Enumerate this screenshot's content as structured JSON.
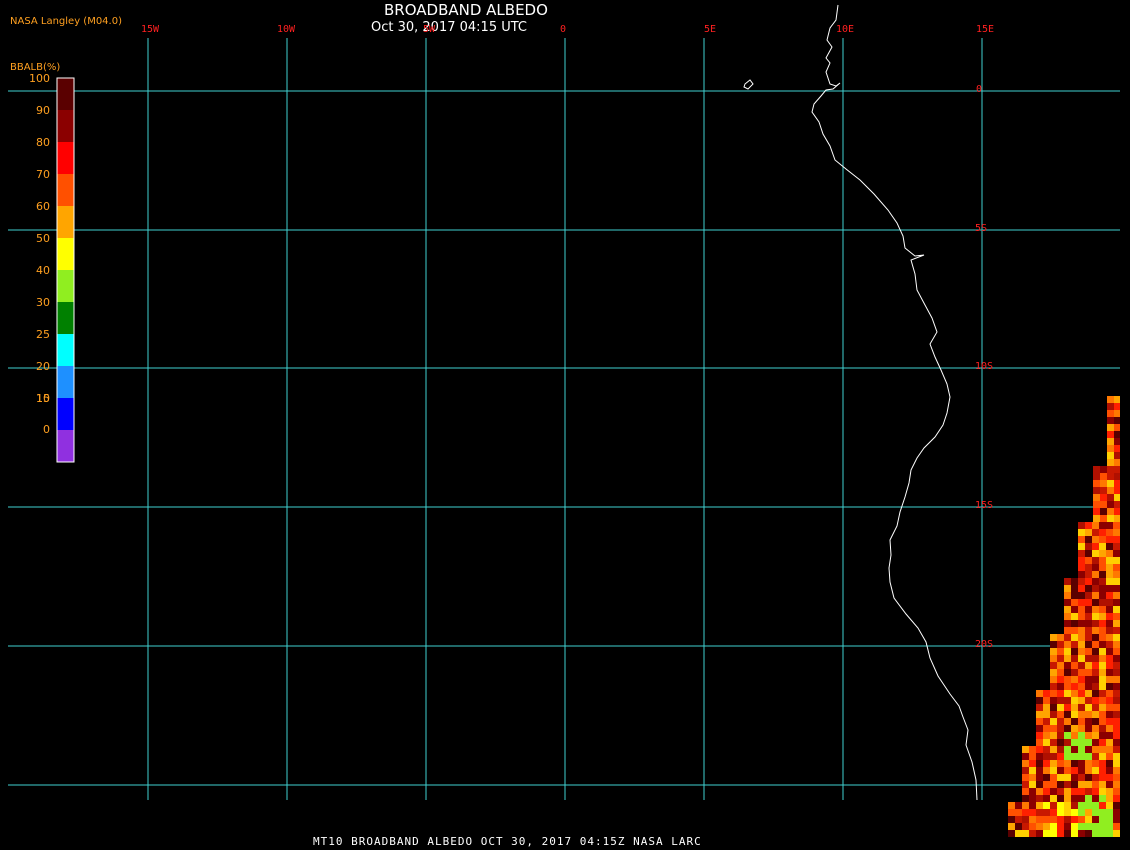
{
  "header": {
    "title": "BROADBAND ALBEDO",
    "subtitle": "Oct 30, 2017 04:15 UTC",
    "source": "NASA Langley (M04.0)"
  },
  "footer": {
    "text": "MT10  BROADBAND ALBEDO   OCT 30, 2017 04:15Z   NASA LARC"
  },
  "colorbar": {
    "title": "BBALB(%)",
    "ticks": [
      "100",
      "90",
      "80",
      "70",
      "60",
      "50",
      "40",
      "30",
      "25",
      "20",
      "15",
      "10",
      "0"
    ],
    "colors": [
      "#5a0000",
      "#8b0000",
      "#ff0000",
      "#ff5000",
      "#ffa500",
      "#ffff00",
      "#90ee20",
      "#008000",
      "#00ffff",
      "#1e90ff",
      "#0000ff",
      "#9030e0"
    ]
  },
  "map": {
    "longitude_labels": [
      "15W",
      "10W",
      "5W",
      "0",
      "5E",
      "10E",
      "15E"
    ],
    "latitude_labels": [
      "0",
      "5S",
      "10S",
      "15S",
      "20S"
    ],
    "grid_color": "#40d0d0",
    "label_color": "#ff2020",
    "coast_color": "#ffffff"
  }
}
